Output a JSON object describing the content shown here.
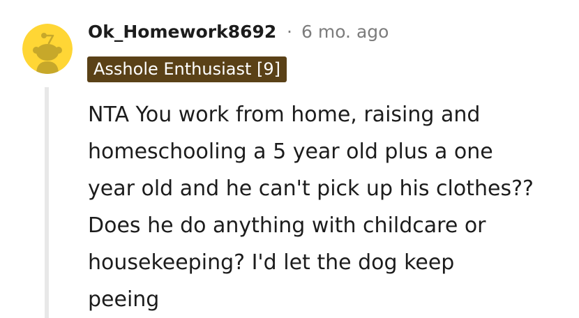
{
  "comment": {
    "username": "Ok_Homework8692",
    "separator": "·",
    "timestamp": "6 mo. ago",
    "flair": "Asshole Enthusiast [9]",
    "body": "NTA You work from home, raising and\nhomeschooling a 5 year old plus a one\nyear old and he can't pick up his clothes??\nDoes he do anything with childcare or\nhousekeeping? I'd let the dog keep\npeeing"
  },
  "avatar": {
    "icon": "snoo-avatar-icon",
    "background_color": "#FFD635",
    "figure_color": "#C7A82A"
  },
  "colors": {
    "flair_background": "#5A4117",
    "timestamp": "#7C7C7C",
    "text": "#1C1C1C",
    "thread_line": "#E8E8E8"
  }
}
